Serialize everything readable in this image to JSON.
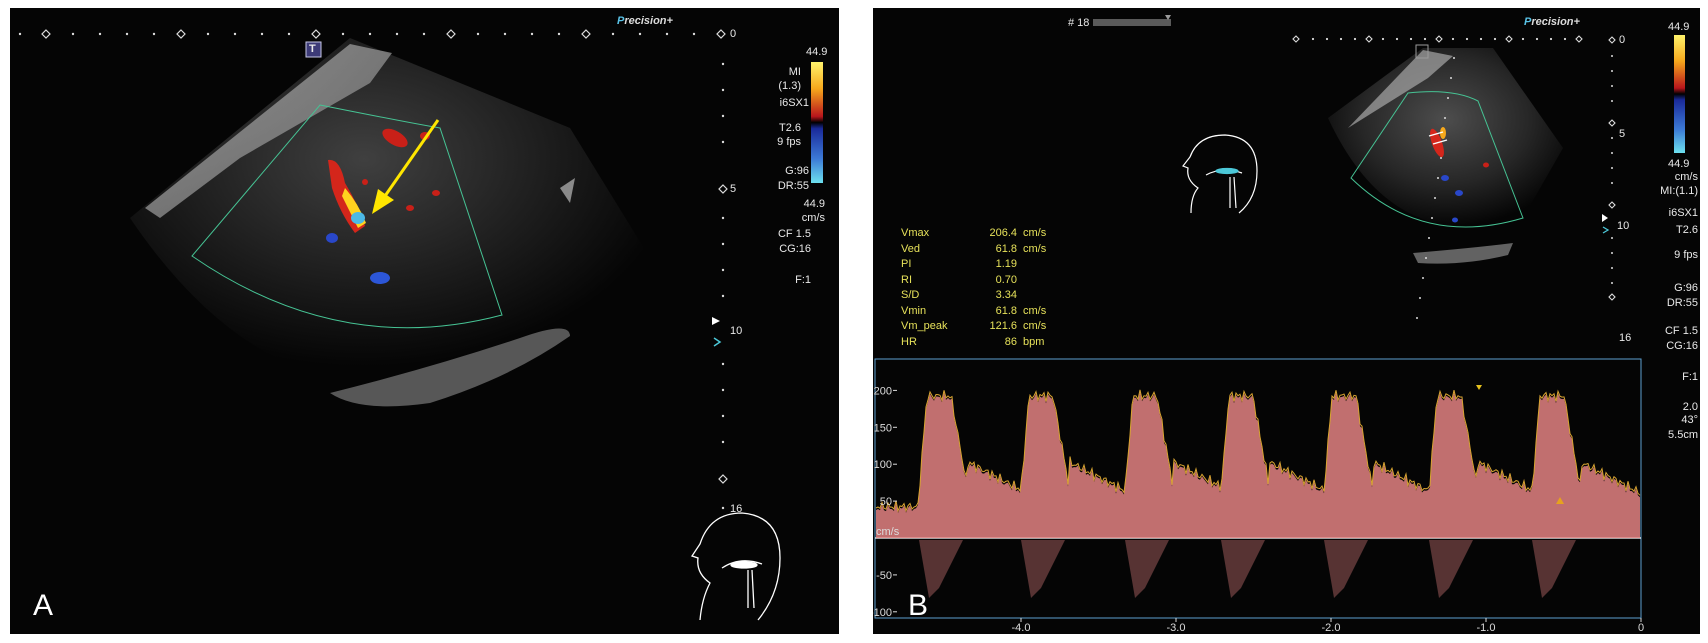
{
  "panel_a": {
    "letter": "A",
    "brand_prefix": "P",
    "brand_rest": "recision",
    "brand_plus": "+",
    "t_marker": "T",
    "depth_labels": [
      "0",
      "5",
      "10",
      "16"
    ],
    "colorbar_top": "44.9",
    "info_lines": [
      "MI",
      "(1.3)",
      "i6SX1",
      "T2.6",
      "9 fps",
      "G:96",
      "DR:55",
      "44.9",
      "cm/s",
      "CF 1.5",
      "CG:16",
      "F:1"
    ],
    "arrow_color": "#ffe600"
  },
  "panel_b": {
    "letter": "B",
    "frame_label": "# 18",
    "brand_prefix": "P",
    "brand_rest": "recision",
    "brand_plus": "+",
    "depth_labels": [
      "0",
      "5",
      "10",
      "16"
    ],
    "colorbar_top": "44.9",
    "colorbar_bottom": "44.9",
    "info_lines": [
      "cm/s",
      "MI:(1.1)",
      "i6SX1",
      "T2.6",
      "9 fps",
      "G:96",
      "DR:55",
      "CF 1.5",
      "CG:16",
      "F:1",
      "2.0",
      "43°",
      "5.5cm"
    ],
    "measurements": [
      {
        "name": "Vmax",
        "value": "206.4",
        "unit": "cm/s"
      },
      {
        "name": "Ved",
        "value": "61.8",
        "unit": "cm/s"
      },
      {
        "name": "PI",
        "value": "1.19",
        "unit": ""
      },
      {
        "name": "RI",
        "value": "0.70",
        "unit": ""
      },
      {
        "name": "S/D",
        "value": "3.34",
        "unit": ""
      },
      {
        "name": "Vmin",
        "value": "61.8",
        "unit": "cm/s"
      },
      {
        "name": "Vm_peak",
        "value": "121.6",
        "unit": "cm/s"
      },
      {
        "name": "HR",
        "value": "86",
        "unit": "bpm"
      }
    ],
    "doppler": {
      "y_unit": "cm/s",
      "y_ticks": [
        "200",
        "150",
        "100",
        "50",
        "-50",
        "-100"
      ],
      "x_ticks": [
        "-4.0",
        "-3.0",
        "-2.0",
        "-1.0",
        "0"
      ],
      "measurement_color": "#e6e15a",
      "spectrum_color": "#f08a8a",
      "envelope_color": "#d9a531",
      "frame_color": "#5d9fcf"
    }
  }
}
